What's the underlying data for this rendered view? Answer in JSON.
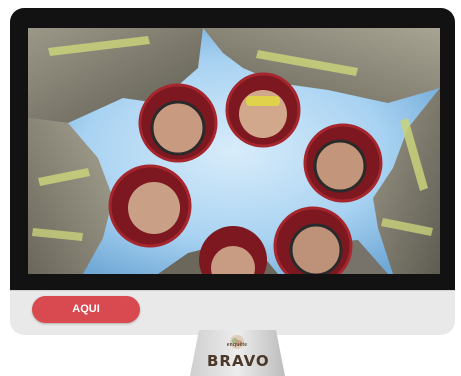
{
  "cta": {
    "label": "AQUI"
  },
  "logo": {
    "small_text": "enquête",
    "main_text": "BRAVO"
  },
  "icons": {
    "photo": "firefighters-huddle-photo",
    "emblem": "logo-emblem-icon"
  },
  "colors": {
    "bezel": "#121212",
    "chin": "#e9e9e9",
    "cta": "#d84a4f",
    "sky": "#8fc2ea",
    "helmet": "#8b1a1f",
    "logo_text": "#4a3728"
  }
}
